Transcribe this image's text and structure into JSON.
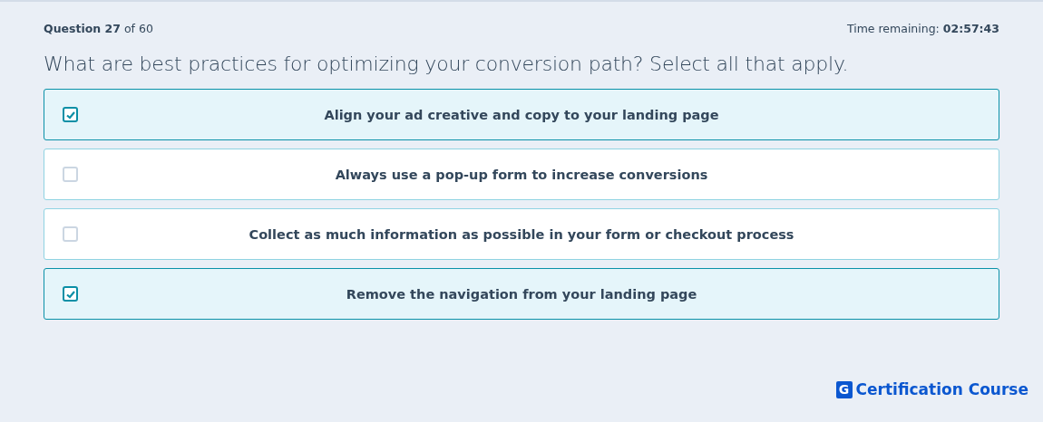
{
  "progress": "**Question 27** of 60",
  "timer": "Time remaining: **02:57:43**",
  "question": "What are best practices for optimizing your conversion path? Select all that apply.",
  "options": [
    {
      "label": "Align your ad creative and copy to your landing page",
      "checked": true
    },
    {
      "label": "Always use a pop-up form to increase conversions",
      "checked": false
    },
    {
      "label": "Collect as much information as possible in your form or checkout process",
      "checked": false
    },
    {
      "label": "Remove the navigation from your landing page",
      "checked": true
    }
  ],
  "brand": {
    "mark": "G",
    "name": "Certification Course"
  }
}
